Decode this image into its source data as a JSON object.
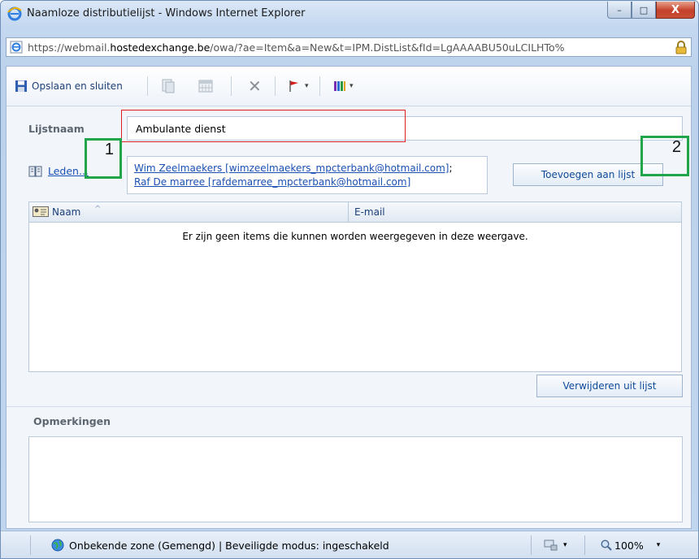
{
  "window": {
    "title": "Naamloze distributielijst - Windows Internet Explorer",
    "min_glyph": "–",
    "max_glyph": "□",
    "close_glyph": "X"
  },
  "address": {
    "prefix": "https://webmail.",
    "domain": "hostedexchange.be",
    "rest": "/owa/?ae=Item&a=New&t=IPM.DistList&fId=LgAAAABU50uLCILHTo%"
  },
  "toolbar": {
    "save_label": "Opslaan en sluiten",
    "delete_glyph": "✕",
    "dropdown_glyph": "▾"
  },
  "form": {
    "list_name_label": "Lijstnaam",
    "list_name_value": "Ambulante dienst",
    "members_label": "Leden...",
    "members": [
      "Wim Zeelmaekers [wimzeelmaekers_mpcterbank@hotmail.com]",
      "Raf De marree [rafdemarree_mpcterbank@hotmail.com]"
    ],
    "member_separator": ";",
    "add_button": "Toevoegen aan lijst",
    "grid": {
      "col_name": "Naam",
      "col_email": "E-mail",
      "empty_text": "Er zijn geen items die kunnen worden weergegeven in deze weergave."
    },
    "remove_button": "Verwijderen uit lijst",
    "notes_label": "Opmerkingen"
  },
  "annotations": {
    "marker_1": "1",
    "marker_2": "2",
    "box_color": "#e02020",
    "marker_color": "#21a54a"
  },
  "status": {
    "zone_text": "Onbekende zone (Gemengd) | Beveiligde modus: ingeschakeld",
    "zoom": "100%"
  }
}
